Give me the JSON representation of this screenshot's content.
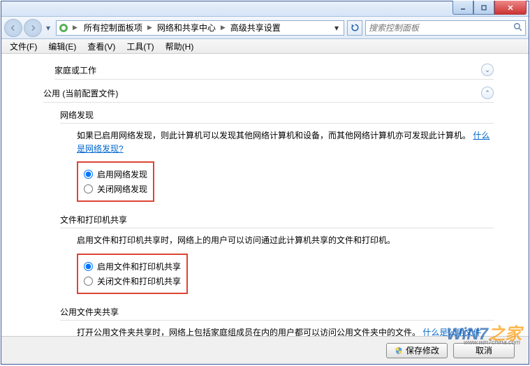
{
  "window": {
    "breadcrumb": [
      "所有控制面板项",
      "网络和共享中心",
      "高级共享设置"
    ],
    "search_placeholder": "搜索控制面板"
  },
  "menu": {
    "file": "文件(F)",
    "edit": "编辑(E)",
    "view": "查看(V)",
    "tools": "工具(T)",
    "help": "帮助(H)"
  },
  "sections": {
    "home": {
      "title": "家庭或工作"
    },
    "public": {
      "title": "公用 (当前配置文件)",
      "network_discovery": {
        "title": "网络发现",
        "desc": "如果已启用网络发现，则此计算机可以发现其他网络计算机和设备，而其他网络计算机亦可发现此计算机。",
        "link": "什么是网络发现?",
        "opt_on": "启用网络发现",
        "opt_off": "关闭网络发现"
      },
      "file_printer": {
        "title": "文件和打印机共享",
        "desc": "启用文件和打印机共享时，网络上的用户可以访问通过此计算机共享的文件和打印机。",
        "opt_on": "启用文件和打印机共享",
        "opt_off": "关闭文件和打印机共享"
      },
      "public_folder": {
        "title": "公用文件夹共享",
        "desc": "打开公用文件夹共享时，网络上包括家庭组成员在内的用户都可以访问公用文件夹中的文件。",
        "link": "什么是公用文件夹?"
      }
    }
  },
  "buttons": {
    "save": "保存修改",
    "cancel": "取消"
  },
  "watermark": {
    "t1": "WiN7",
    "t2": "之家",
    "sub": "www.win7china.com"
  }
}
